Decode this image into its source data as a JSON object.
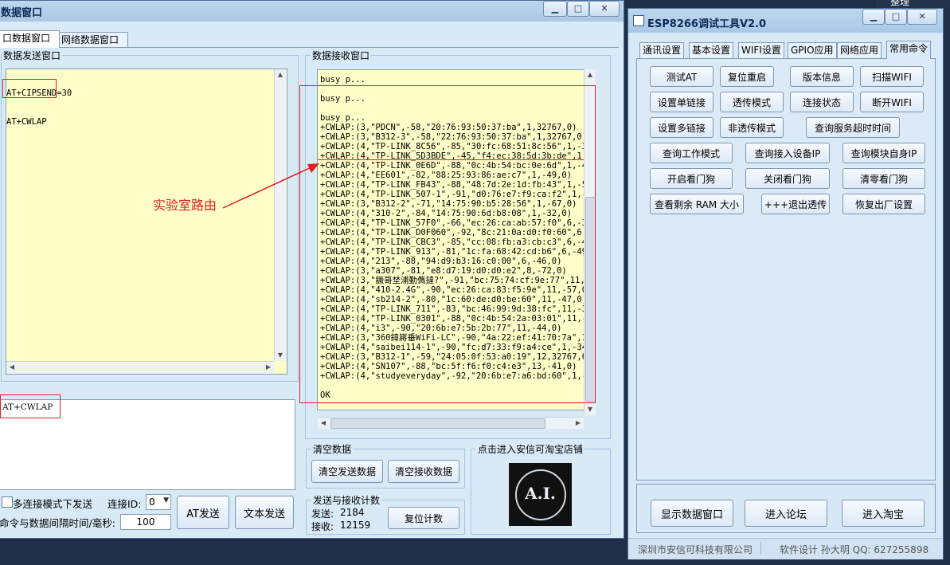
{
  "left_window": {
    "title": "数据窗口",
    "tabs": [
      "口数据窗口",
      "网络数据窗口"
    ],
    "send_group_label": "数据发送窗口",
    "send_text": [
      "AT+CIPSEND=30",
      "AT+CWLAP"
    ],
    "input_text": "AT+CWLAP",
    "multi_conn_label": "多连接模式下发送",
    "conn_id_label": "连接ID:",
    "conn_id_value": "0",
    "interval_label": "命令与数据间隔时间/毫秒:",
    "interval_value": "100",
    "at_send_button": "AT发送",
    "text_send_button": "文本发送",
    "receive_group_label": "数据接收窗口",
    "receive_lines": [
      "busy p...",
      "",
      "busy p...",
      "",
      "busy p...",
      "+CWLAP:(3,\"PDCN\",-58,\"20:76:93:50:37:ba\",1,32767,0)",
      "+CWLAP:(3,\"B312-3\",-58,\"22:76:93:50:37:ba\",1,32767,0)",
      "+CWLAP:(4,\"TP-LINK_8C56\",-85,\"30:fc:68:51:8c:56\",1,-36,0",
      "+CWLAP:(4,\"TP-LINK_5D3BDE\",-45,\"f4:ec:38:5d:3b:de\",1,-7",
      "+CWLAP:(4,\"TP-LINK_0E6D\",-88,\"0c:4b:54:bc:0e:6d\",1,-47,0",
      "+CWLAP:(4,\"EE601\",-82,\"88:25:93:86:ae:c7\",1,-49,0)",
      "+CWLAP:(4,\"TP-LINK_FB43\",-88,\"48:7d:2e:1d:fb:43\",1,-51,0",
      "+CWLAP:(4,\"TP-LINK_507-1\",-91,\"d0:76:e7:f9:ca:f2\",1,-14,",
      "+CWLAP:(3,\"B312-2\",-71,\"14:75:90:b5:28:56\",1,-67,0)",
      "+CWLAP:(4,\"310-2\",-84,\"14:75:90:6d:b8:08\",1,-32,0)",
      "+CWLAP:(4,\"TP-LINK_57F0\",-66,\"ec:26:ca:ab:57:f0\",6,-37,0",
      "+CWLAP:(4,\"TP-LINK_D0F060\",-92,\"8c:21:0a:d0:f0:60\",6,-6",
      "+CWLAP:(4,\"TP-LINK_CBC3\",-85,\"cc:08:fb:a3:cb:c3\",6,-46,0",
      "+CWLAP:(4,\"TP-LINK_913\",-81,\"1c:fa:68:42:cd:b6\",6,-49,0",
      "+CWLAP:(4,\"213\",-88,\"94:d9:b3:16:c0:00\",6,-46,0)",
      "+CWLAP:(3,\"a307\",-81,\"e8:d7:19:d0:d0:e2\",8,-72,0)",
      "+CWLAP:(3,\"鐝哥埜浦勤儁撻?\",-91,\"bc:75:74:cf:9e:77\",11,-",
      "+CWLAP:(4,\"410-2.4G\",-90,\"ec:26:ca:83:f5:9e\",11,-57,0)",
      "+CWLAP:(4,\"sb214-2\",-80,\"1c:60:de:d0:be:60\",11,-47,0)",
      "+CWLAP:(4,\"TP-LINK_711\",-83,\"bc:46:99:9d:38:fc\",11,-37,0",
      "+CWLAP:(4,\"TP-LINK_0301\",-88,\"0c:4b:54:2a:03:01\",11,-46,",
      "+CWLAP:(4,\"i3\",-90,\"20:6b:e7:5b:2b:77\",11,-44,0)",
      "+CWLAP:(3,\"360鍏嶈垂WiFi-LC\",-90,\"4a:22:ef:41:70:7a\",11,",
      "+CWLAP:(4,\"saibei114-1\",-90,\"fc:d7:33:f9:a4:ce\",1,-34,0",
      "+CWLAP:(3,\"B312-1\",-59,\"24:05:0f:53:a0:19\",12,32767,0)",
      "+CWLAP:(4,\"SN107\",-88,\"bc:5f:f6:f0:c4:e3\",13,-41,0)",
      "+CWLAP:(4,\"studyeveryday\",-92,\"20:6b:e7:a6:bd:60\",1,-49,",
      "",
      "OK"
    ],
    "clear_group_label": "清空数据",
    "clear_send_button": "清空发送数据",
    "clear_receive_button": "清空接收数据",
    "count_group_label": "发送与接收计数",
    "send_count_label": "发送:",
    "send_count": "2184",
    "recv_count_label": "接收:",
    "recv_count": "12159",
    "reset_count_button": "复位计数",
    "shop_group_label": "点击进入安信可淘宝店铺",
    "logo_text": "A.I.",
    "annotation": "实验室路由"
  },
  "right_window": {
    "title": "ESP8266调试工具V2.0",
    "tabs": [
      "通讯设置",
      "基本设置",
      "WIFI设置",
      "GPIO应用",
      "网络应用",
      "常用命令"
    ],
    "buttons": [
      [
        "测试AT",
        "复位重启",
        "版本信息",
        "扫描WIFI"
      ],
      [
        "设置单链接",
        "透传模式",
        "连接状态",
        "断开WIFI"
      ],
      [
        "设置多链接",
        "非透传模式",
        "查询服务超时时间"
      ],
      [
        "查询工作模式",
        "查询接入设备IP",
        "查询模块自身IP"
      ],
      [
        "开启看门狗",
        "关闭看门狗",
        "清零看门狗"
      ],
      [
        "查看剩余 RAM 大小",
        "+++退出透传",
        "恢复出厂设置"
      ]
    ],
    "bottom_buttons": [
      "显示数据窗口",
      "进入论坛",
      "进入淘宝"
    ],
    "status_company": "深圳市安信可科技有限公司",
    "status_author": "软件设计 孙大明 QQ: 627255898"
  },
  "desktop": {
    "top_right_label": "整理"
  }
}
